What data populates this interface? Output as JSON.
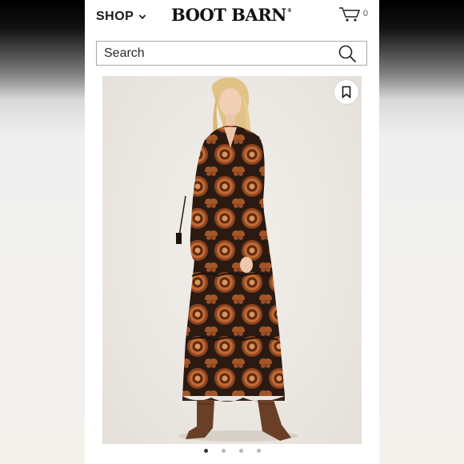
{
  "header": {
    "shop_label": "SHOP",
    "logo_text": "BOOT BARN",
    "cart_count": "0"
  },
  "search": {
    "placeholder": "Search"
  },
  "product": {
    "image_alt": "Model wearing a long-sleeve paisley medallion print tiered maxi dress with brown western boots"
  },
  "carousel": {
    "dot_count": 4,
    "active_index": 0
  },
  "colors": {
    "dress_base": "#2a1a12",
    "dress_pattern": "#b5632e",
    "boots": "#6b3f27",
    "hair": "#e6c98c"
  },
  "icons": {
    "shop_chevron": "chevron-down-icon",
    "cart": "cart-icon",
    "search": "search-icon",
    "bookmark": "bookmark-icon"
  }
}
